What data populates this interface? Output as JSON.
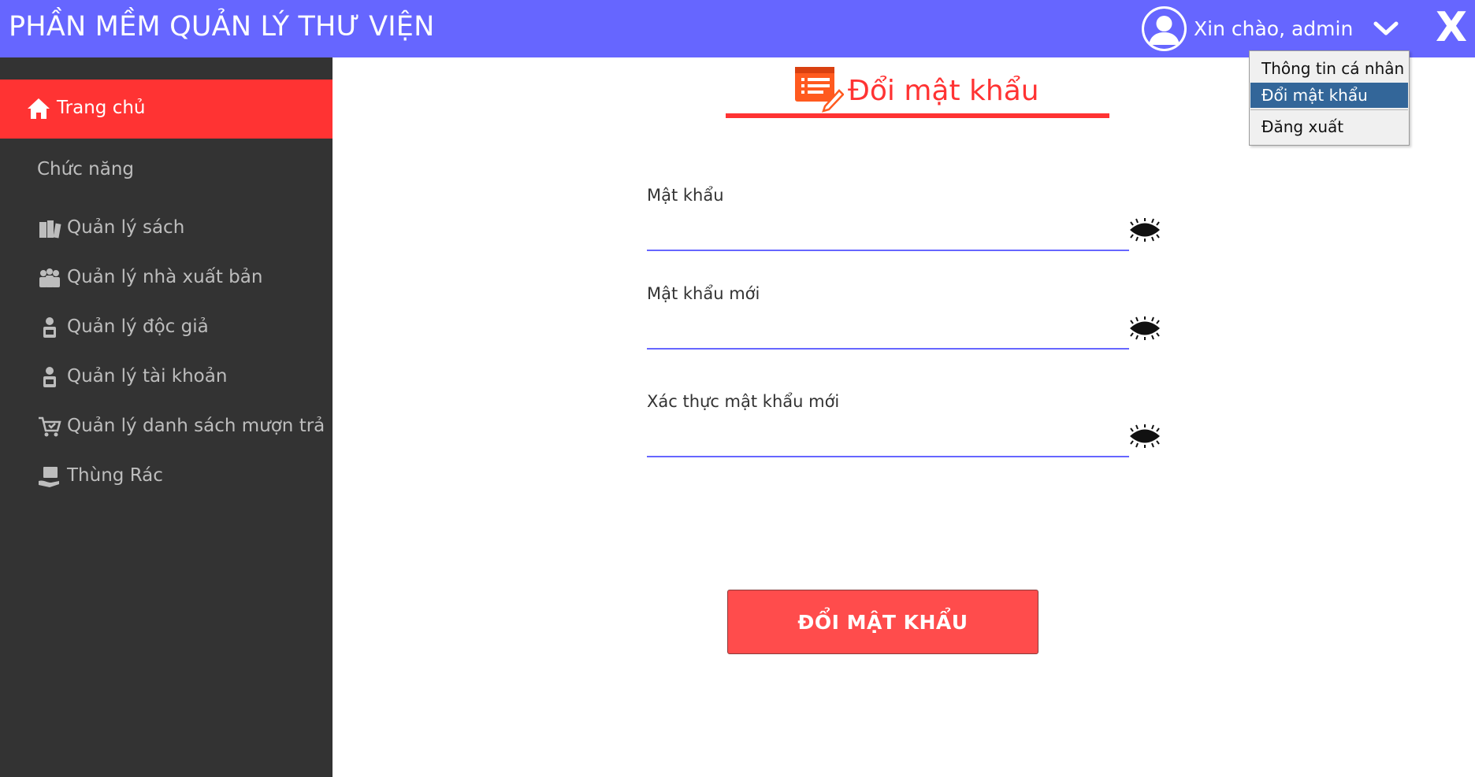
{
  "header": {
    "title": "PHẦN MỀM QUẢN LÝ THƯ VIỆN",
    "greeting": "Xin chào, admin",
    "close_label": "X",
    "avatar_icon": "user-avatar-icon",
    "dropdown_icon": "chevron-down-icon"
  },
  "sidebar": {
    "home": {
      "label": "Trang chủ",
      "icon": "home-icon"
    },
    "section_label": "Chức năng",
    "items": [
      {
        "label": "Quản lý sách",
        "icon": "books-icon"
      },
      {
        "label": "Quản lý nhà xuất bản",
        "icon": "publishers-icon"
      },
      {
        "label": "Quản lý độc giả",
        "icon": "reader-icon"
      },
      {
        "label": "Quản lý tài khoản",
        "icon": "account-icon"
      },
      {
        "label": "Quản lý danh sách mượn trả",
        "icon": "cart-icon"
      },
      {
        "label": "Thùng Rác",
        "icon": "trash-icon"
      }
    ]
  },
  "main": {
    "title": "Đổi mật khẩu",
    "title_icon": "edit-document-icon",
    "fields": [
      {
        "label": "Mật khẩu",
        "value": ""
      },
      {
        "label": "Mật khẩu mới",
        "value": ""
      },
      {
        "label": "Xác thực mật khẩu mới",
        "value": ""
      }
    ],
    "submit_label": "ĐỔI MẬT KHẨU"
  },
  "dropdown": {
    "items": [
      "Thông tin cá nhân",
      "Đổi mật khẩu",
      "Đăng xuất"
    ],
    "selected": "Đổi mật khẩu"
  },
  "colors": {
    "header_bg": "#6666ff",
    "sidebar_bg": "#333333",
    "accent": "#ff3333",
    "button_bg": "#ff4c4c",
    "dropdown_selected": "#336699"
  }
}
